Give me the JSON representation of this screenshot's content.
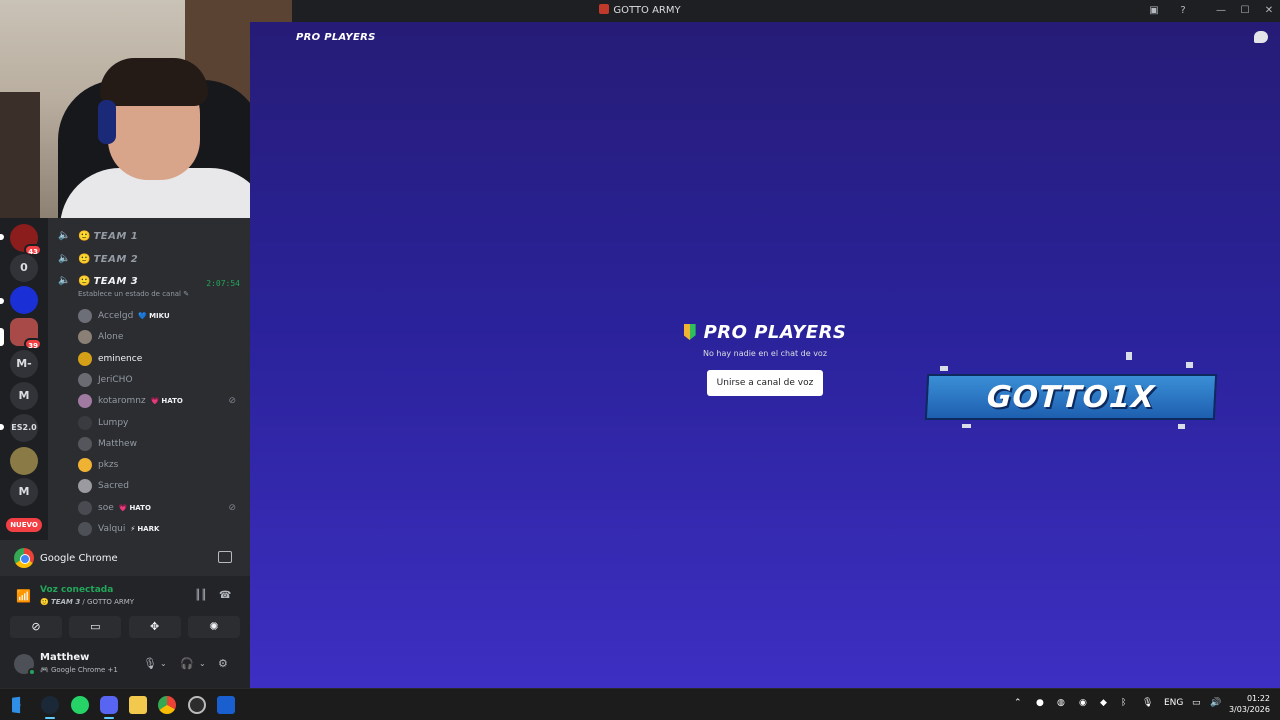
{
  "window": {
    "title": "GOTTO ARMY",
    "controls": {
      "minimize": "—",
      "maximize": "☐",
      "close": "✕"
    }
  },
  "servers": [
    {
      "label": "",
      "badge": "43"
    },
    {
      "label": "0",
      "badge": ""
    },
    {
      "label": "",
      "badge": ""
    },
    {
      "label": "",
      "badge": "39"
    },
    {
      "label": "M-",
      "badge": ""
    },
    {
      "label": "M",
      "badge": ""
    },
    {
      "label": "ES2.0",
      "badge": ""
    },
    {
      "label": "",
      "badge": ""
    },
    {
      "label": "M",
      "badge": ""
    }
  ],
  "servers_new_label": "NUEVO",
  "channels": {
    "team1": {
      "emoji": "🙂",
      "name": "TEAM 1"
    },
    "team2": {
      "emoji": "🙂",
      "name": "TEAM 2"
    },
    "team3": {
      "emoji": "🙂",
      "name": "TEAM 3",
      "timer": "2:07:54",
      "status_prompt": "Establece un estado de canal ✎"
    }
  },
  "members": [
    {
      "name": "Accelgd",
      "tag": "MIKU",
      "tag_icon": "💙",
      "bright": false,
      "muted": false
    },
    {
      "name": "Alone",
      "tag": "",
      "tag_icon": "",
      "bright": false,
      "muted": false
    },
    {
      "name": "eminence",
      "tag": "",
      "tag_icon": "",
      "bright": true,
      "muted": false
    },
    {
      "name": "JeriCHO",
      "tag": "",
      "tag_icon": "",
      "bright": false,
      "muted": false
    },
    {
      "name": "kotaromnz",
      "tag": "HATO",
      "tag_icon": "💗",
      "bright": false,
      "muted": true
    },
    {
      "name": "Lumpy",
      "tag": "",
      "tag_icon": "",
      "bright": false,
      "muted": false
    },
    {
      "name": "Matthew",
      "tag": "",
      "tag_icon": "",
      "bright": false,
      "muted": false
    },
    {
      "name": "pkzs",
      "tag": "",
      "tag_icon": "",
      "bright": false,
      "muted": false
    },
    {
      "name": "Sacred",
      "tag": "",
      "tag_icon": "",
      "bright": false,
      "muted": false
    },
    {
      "name": "soe",
      "tag": "HATO",
      "tag_icon": "💗",
      "bright": false,
      "muted": true
    },
    {
      "name": "Valqui",
      "tag": "HARK",
      "tag_icon": "⚡",
      "bright": false,
      "muted": false
    }
  ],
  "stream": {
    "app_name": "Google Chrome"
  },
  "voice": {
    "status": "Voz conectada",
    "channel": "TEAM 3",
    "separator": " / ",
    "server": "GOTTO ARMY"
  },
  "user": {
    "name": "Matthew",
    "activity": "Google Chrome +1"
  },
  "main": {
    "header_title": "PRO PLAYERS",
    "empty_title": "PRO PLAYERS",
    "empty_subtitle": "No hay nadie en el chat de voz",
    "join_button": "Unirse a canal de voz",
    "banner_text": "GOTTO1X"
  },
  "taskbar": {
    "lang": "ENG",
    "time": "01:22",
    "date": "3/03/2026"
  },
  "colors": {
    "accent_green": "#23a55a",
    "badge_red": "#f23f43",
    "main_bg": "#2a229a"
  }
}
